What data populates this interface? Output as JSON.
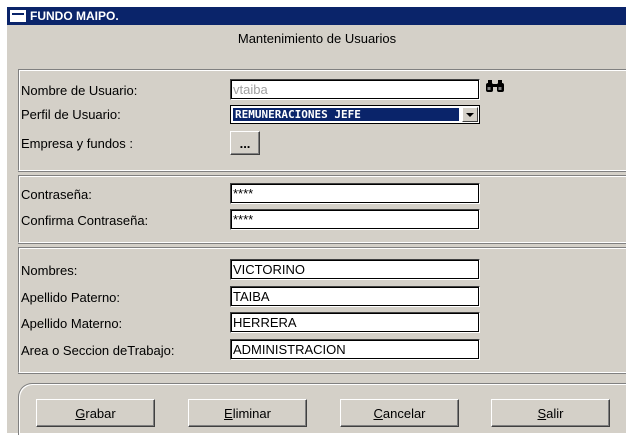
{
  "window": {
    "title": "FUNDO MAIPO."
  },
  "form": {
    "title": "Mantenimiento de Usuarios"
  },
  "user_section": {
    "username_label": "Nombre de Usuario:",
    "username_value": "vtaiba",
    "profile_label": "Perfil de Usuario:",
    "profile_value": "REMUNERACIONES JEFE",
    "company_label": "Empresa y fundos :",
    "company_button_label": "..."
  },
  "password_section": {
    "password_label": "Contraseña:",
    "password_value": "****",
    "confirm_label": "Confirma Contraseña:",
    "confirm_value": "****"
  },
  "personal_section": {
    "names_label": "Nombres:",
    "names_value": "VICTORINO",
    "paternal_label": "Apellido Paterno:",
    "paternal_value": "TAIBA",
    "maternal_label": "Apellido Materno:",
    "maternal_value": "HERRERA",
    "area_label": "Area o Seccion deTrabajo:",
    "area_value": "ADMINISTRACION"
  },
  "actions": {
    "save": {
      "mnemonic": "G",
      "rest": "rabar"
    },
    "delete": {
      "mnemonic": "E",
      "rest": "liminar"
    },
    "cancel": {
      "mnemonic": "C",
      "rest": "ancelar"
    },
    "exit": {
      "mnemonic": "S",
      "rest": "alir"
    }
  },
  "colors": {
    "titlebar": "#0a246a",
    "face": "#d4d0c8",
    "selection": "#0a246a"
  },
  "icons": {
    "app": "window-icon",
    "search": "binoculars-icon",
    "dropdown": "chevron-down-icon"
  }
}
